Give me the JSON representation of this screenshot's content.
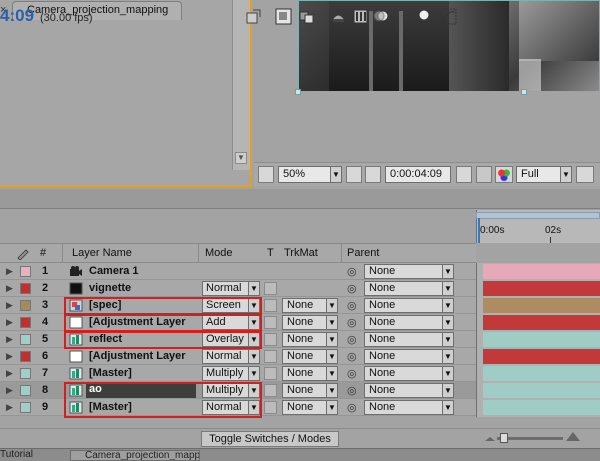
{
  "viewer": {
    "zoom": "50%",
    "timecode": "0:00:04:09",
    "resolution": "Full"
  },
  "tab": {
    "name": "Camera_projection_mapping"
  },
  "timeline": {
    "current_time": "4:09",
    "fps": "(30.00 fps)",
    "ruler_start": "0:00s",
    "ruler_mark": "02s"
  },
  "columns": {
    "num": "#",
    "layer_name": "Layer Name",
    "mode": "Mode",
    "t": "T",
    "trkmat": "TrkMat",
    "parent": "Parent"
  },
  "layers": [
    {
      "num": "1",
      "name": "Camera 1",
      "mode": "",
      "trkmat": "",
      "parent": "None",
      "swatch": "#e8b0c0",
      "icon": "camera-icon",
      "bar": "#e6a9b9"
    },
    {
      "num": "2",
      "name": "vignette",
      "mode": "Normal",
      "trkmat": "",
      "parent": "None",
      "swatch": "#c03030",
      "icon": "solid-icon",
      "bar": "#c33838"
    },
    {
      "num": "3",
      "name": "[spec]",
      "mode": "Screen",
      "trkmat": "None",
      "parent": "None",
      "swatch": "#a88a5a",
      "icon": "precomp-icon",
      "bar": "#ad8c63"
    },
    {
      "num": "4",
      "name": "[Adjustment Layer",
      "mode": "Add",
      "trkmat": "None",
      "parent": "None",
      "swatch": "#c03030",
      "icon": "adjustment-icon",
      "bar": "#c33838"
    },
    {
      "num": "5",
      "name": "reflect",
      "mode": "Overlay",
      "trkmat": "None",
      "parent": "None",
      "swatch": "#9fd0c8",
      "icon": "footage-icon",
      "bar": "#9fcdc5"
    },
    {
      "num": "6",
      "name": "[Adjustment Layer",
      "mode": "Normal",
      "trkmat": "None",
      "parent": "None",
      "swatch": "#c03030",
      "icon": "adjustment-icon",
      "bar": "#c33838"
    },
    {
      "num": "7",
      "name": "[Master]",
      "mode": "Multiply",
      "trkmat": "None",
      "parent": "None",
      "swatch": "#9fd0c8",
      "icon": "footage-icon",
      "bar": "#9fcdc5"
    },
    {
      "num": "8",
      "name": "ao",
      "mode": "Multiply",
      "trkmat": "None",
      "parent": "None",
      "swatch": "#9fd0c8",
      "icon": "footage-icon",
      "bar": "#9fcdc5"
    },
    {
      "num": "9",
      "name": "[Master]",
      "mode": "Normal",
      "trkmat": "None",
      "parent": "None",
      "swatch": "#9fd0c8",
      "icon": "footage-icon",
      "bar": "#9fcdc5"
    }
  ],
  "bottom": {
    "toggle_label": "Toggle Switches / Modes",
    "task_tab": "Camera_projection_mapping",
    "task_prev": "Tutorial"
  }
}
